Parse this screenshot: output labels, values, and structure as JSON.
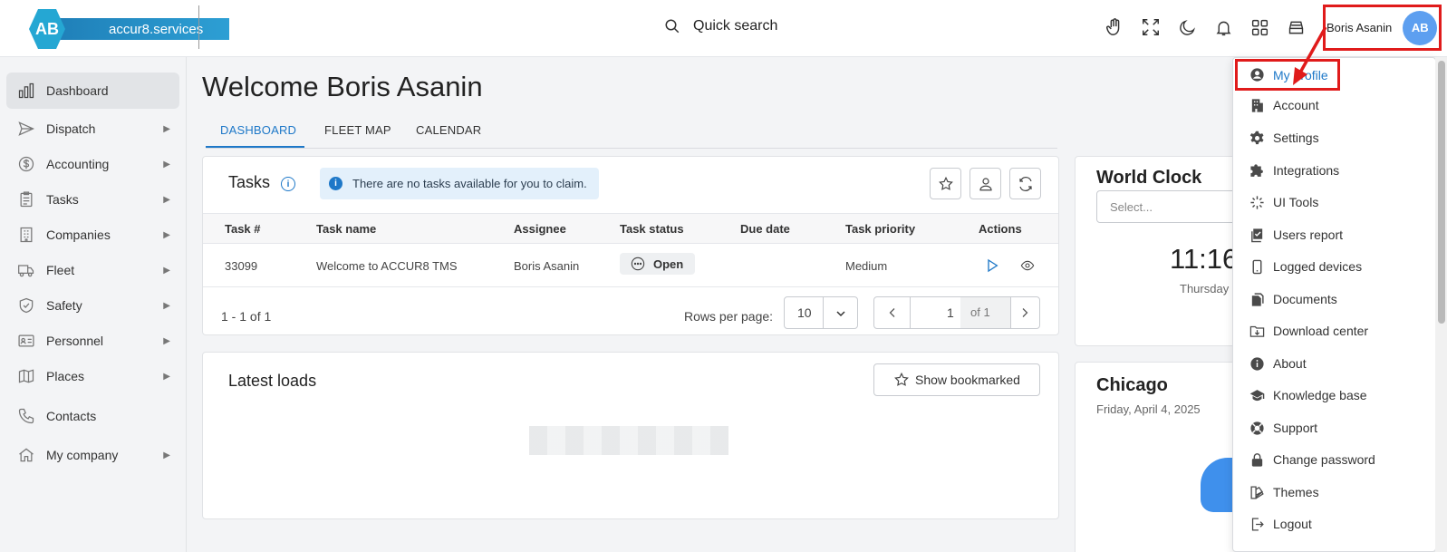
{
  "header": {
    "logo_letters": "AB",
    "logo_text": "accur8.services",
    "search_label": "Quick search",
    "user_name": "Boris Asanin",
    "user_initials": "AB",
    "icons": [
      "hand-icon",
      "fullscreen-icon",
      "dark-mode-icon",
      "notifications-icon",
      "apps-grid-icon",
      "archive-icon"
    ]
  },
  "sidebar": {
    "items": [
      {
        "label": "Dashboard",
        "icon": "bar-chart-icon",
        "active": true,
        "has_submenu": false
      },
      {
        "label": "Dispatch",
        "icon": "send-icon",
        "has_submenu": true
      },
      {
        "label": "Accounting",
        "icon": "dollar-circle-icon",
        "has_submenu": true
      },
      {
        "label": "Tasks",
        "icon": "clipboard-icon",
        "has_submenu": true
      },
      {
        "label": "Companies",
        "icon": "building-icon",
        "has_submenu": true
      },
      {
        "label": "Fleet",
        "icon": "truck-icon",
        "has_submenu": true
      },
      {
        "label": "Safety",
        "icon": "shield-check-icon",
        "has_submenu": true
      },
      {
        "label": "Personnel",
        "icon": "id-card-icon",
        "has_submenu": true
      },
      {
        "label": "Places",
        "icon": "map-icon",
        "has_submenu": true
      },
      {
        "label": "Contacts",
        "icon": "phone-icon",
        "has_submenu": false
      },
      {
        "label": "My company",
        "icon": "home-icon",
        "has_submenu": true
      }
    ]
  },
  "main": {
    "title": "Welcome Boris Asanin",
    "tabs": [
      {
        "label": "DASHBOARD",
        "active": true
      },
      {
        "label": "FLEET MAP"
      },
      {
        "label": "CALENDAR"
      }
    ],
    "tasks": {
      "title": "Tasks",
      "info_mark": "i",
      "alert": "There are no tasks available for you to claim.",
      "columns": [
        "Task #",
        "Task name",
        "Assignee",
        "Task status",
        "Due date",
        "Task priority",
        "Actions"
      ],
      "rows": [
        {
          "number": "33099",
          "name": "Welcome to ACCUR8 TMS",
          "assignee": "Boris Asanin",
          "status": "Open",
          "due": "",
          "priority": "Medium"
        }
      ],
      "range": "1 - 1 of 1",
      "rows_per_page_label": "Rows per page:",
      "rows_per_page": "10",
      "page": "1",
      "page_of": "of 1"
    },
    "loads": {
      "title": "Latest loads",
      "bookmark_label": "Show bookmarked"
    },
    "world_clock": {
      "title": "World Clock",
      "select_placeholder": "Select...",
      "time": "11:16",
      "day": "Thursday"
    },
    "weather": {
      "city": "Chicago",
      "date": "Friday, April 4, 2025"
    }
  },
  "profile_menu": {
    "items": [
      {
        "label": "My profile",
        "icon": "user-circle-icon",
        "highlight": true
      },
      {
        "label": "Account",
        "icon": "office-building-icon"
      },
      {
        "label": "Settings",
        "icon": "gear-icon"
      },
      {
        "label": "Integrations",
        "icon": "puzzle-icon"
      },
      {
        "label": "UI Tools",
        "icon": "sparkle-icon"
      },
      {
        "label": "Users report",
        "icon": "report-check-icon"
      },
      {
        "label": "Logged devices",
        "icon": "mobile-device-icon"
      },
      {
        "label": "Documents",
        "icon": "documents-icon"
      },
      {
        "label": "Download center",
        "icon": "download-folder-icon"
      },
      {
        "label": "About",
        "icon": "info-circle-icon"
      },
      {
        "label": "Knowledge base",
        "icon": "graduation-cap-icon"
      },
      {
        "label": "Support",
        "icon": "lifebuoy-icon"
      },
      {
        "label": "Change password",
        "icon": "lock-icon"
      },
      {
        "label": "Themes",
        "icon": "palette-icon"
      },
      {
        "label": "Logout",
        "icon": "logout-icon"
      }
    ]
  },
  "annotation_color": "#e01b1b",
  "accent_color": "#1e78c8"
}
